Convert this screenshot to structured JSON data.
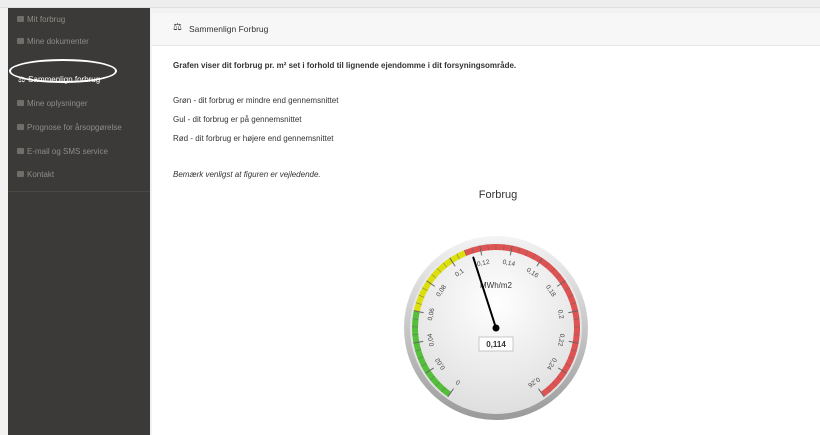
{
  "sidebar": {
    "items": [
      {
        "label": "Mit forbrug",
        "icon": "bar-chart-icon"
      },
      {
        "label": "Mine dokumenter",
        "icon": "document-icon"
      },
      {
        "label": "Sammenlign forbrug",
        "icon": "balance-scale-icon"
      },
      {
        "label": "Mine oplysninger",
        "icon": "id-card-icon"
      },
      {
        "label": "Prognose for årsopgørelse",
        "icon": "calculator-icon"
      },
      {
        "label": "E-mail og SMS service",
        "icon": "envelope-icon"
      },
      {
        "label": "Kontakt",
        "icon": "truck-icon"
      }
    ],
    "active_index": 2
  },
  "panel": {
    "icon": "balance-scale-icon",
    "title": "Sammenlign Forbrug",
    "intro": "Grafen viser dit forbrug pr. m² set i forhold til lignende ejendomme i dit forsyningsområde.",
    "legend_green": "Grøn - dit forbrug er mindre end gennemsnittet",
    "legend_yellow": "Gul - dit forbrug er på gennemsnittet",
    "legend_red": "Rød - dit forbrug er højere end gennemsnittet",
    "note": "Bemærk venligst at figuren er vejledende."
  },
  "chart_data": {
    "type": "gauge",
    "title": "Forbrug",
    "unit": "MWh/m2",
    "min": 0,
    "max": 0.26,
    "value": 0.114,
    "value_label": "0,114",
    "tick_labels": [
      "0",
      "0,02",
      "0,04",
      "0,06",
      "0,08",
      "0,1",
      "0,12",
      "0,14",
      "0,16",
      "0,18",
      "0,2",
      "0,22",
      "0,24",
      "0,26"
    ],
    "bands": [
      {
        "from": 0,
        "to": 0.06,
        "color": "#55bf3b"
      },
      {
        "from": 0.06,
        "to": 0.11,
        "color": "#dddf0d"
      },
      {
        "from": 0.11,
        "to": 0.26,
        "color": "#df5353"
      }
    ]
  }
}
